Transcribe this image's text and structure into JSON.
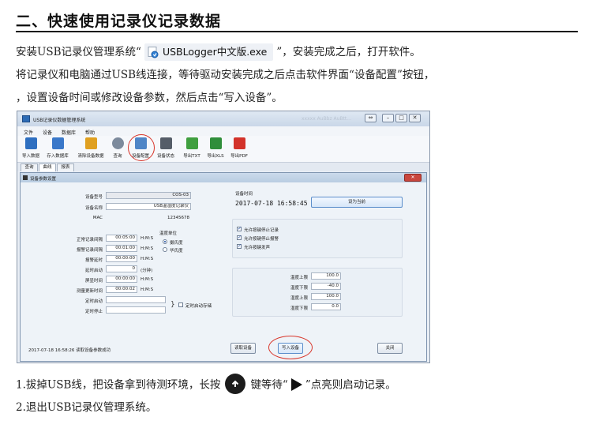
{
  "heading": "二、快速使用记录仪记录数据",
  "para": {
    "line1_pre": "安装USB记录仪管理系统“",
    "installer_file": "USBLogger中文版.exe",
    "line1_post": "”，安装完成之后，打开软件。",
    "line2": "将记录仪和电脑通过USB线连接，等待驱动安装完成之后点击软件界面“设备配置”按钮",
    "line2_tail": "，",
    "line3": "，设置设备时间或修改设备参数，然后点击“写入设备”。"
  },
  "steps": {
    "step1_pre": "1.拔掉USB线，把设备拿到待测环境，长按",
    "step1_mid": "键等待“",
    "step1_post": "”点亮则启动记录。",
    "step2": "2.退出USB记录仪管理系统。"
  },
  "screenshot": {
    "window_title": "USB记录仪数据管理系统",
    "title_blur": "xxxxx AuBbz AuBtt...",
    "window_buttons": [
      "⇔",
      "–",
      "□",
      "✕"
    ],
    "menu": [
      "文件",
      "设备",
      "数据库",
      "帮助"
    ],
    "toolbar": [
      {
        "label": "导入数据",
        "icon": "import-icon",
        "color": "#2e6fc0"
      },
      {
        "label": "存入数据库",
        "icon": "database-save-icon",
        "color": "#3a78c9"
      },
      {
        "label": "清除设备数据",
        "icon": "broom-icon",
        "color": "#e0a020"
      },
      {
        "label": "查询",
        "icon": "magnifier-icon",
        "color": "#7c8a9c"
      },
      {
        "label": "设备配置",
        "icon": "tools-icon",
        "color": "#4f86c7"
      },
      {
        "label": "设备状态",
        "icon": "device-status-icon",
        "color": "#555d68"
      },
      {
        "label": "导出TXT",
        "icon": "export-txt-icon",
        "color": "#3f9f3f"
      },
      {
        "label": "导出XLS",
        "icon": "export-xls-icon",
        "color": "#2f8e3a"
      },
      {
        "label": "导出PDF",
        "icon": "export-pdf-icon",
        "color": "#d3322a"
      }
    ],
    "tabs": [
      "查询",
      "曲线",
      "报表"
    ],
    "dialog": {
      "title": "设备参数设置",
      "close_label": "✕",
      "device_model_label": "设备型号",
      "device_model_value": "COS-03",
      "device_name_label": "设备名称",
      "device_name_value": "USB温湿度记录仪",
      "mac_label": "MAC",
      "mac_value": "12345678",
      "device_time_label": "设备时间",
      "device_time_value": "2017-07-18  16:58:45",
      "set_current_button": "设为当前",
      "normal_interval_label": "正常记录间隔",
      "normal_interval_value": "00:05:00",
      "alarm_interval_label": "报警记录间隔",
      "alarm_interval_value": "00:01:00",
      "alarm_delay_label": "报警延时",
      "alarm_delay_value": "00:00:00",
      "delay_start_label": "延时启动",
      "delay_start_value": "0",
      "delay_start_unit": "(分钟)",
      "screen_time_label": "屏显时间",
      "screen_time_value": "00:00:00",
      "measure_update_label": "测量更新时间",
      "measure_update_value": "00:00:02",
      "time_unit": "H:M:S",
      "timed_start_label": "定时启动",
      "timed_stop_label": "定时停止",
      "timed_switch_label": "定时启动存储",
      "temp_unit_label": "温度单位",
      "celsius_label": "摄氏度",
      "fahrenheit_label": "华氏度",
      "allow_key_stop_label": "允许按键停止记录",
      "allow_key_alarm_label": "允许按键停止报警",
      "allow_key_sound_label": "允许按键发声",
      "temp_high_label": "温度上限",
      "temp_high_value": "100.0",
      "temp_low_label": "温度下限",
      "temp_low_value": "-40.0",
      "hum_high_label": "湿度上限",
      "hum_high_value": "100.0",
      "hum_low_label": "湿度下限",
      "hum_low_value": "0.0",
      "status_text": "2017-07-18  16:58:26  读取设备参数成功",
      "read_button": "读取设备",
      "write_button": "写入设备",
      "close_button": "关闭"
    }
  }
}
